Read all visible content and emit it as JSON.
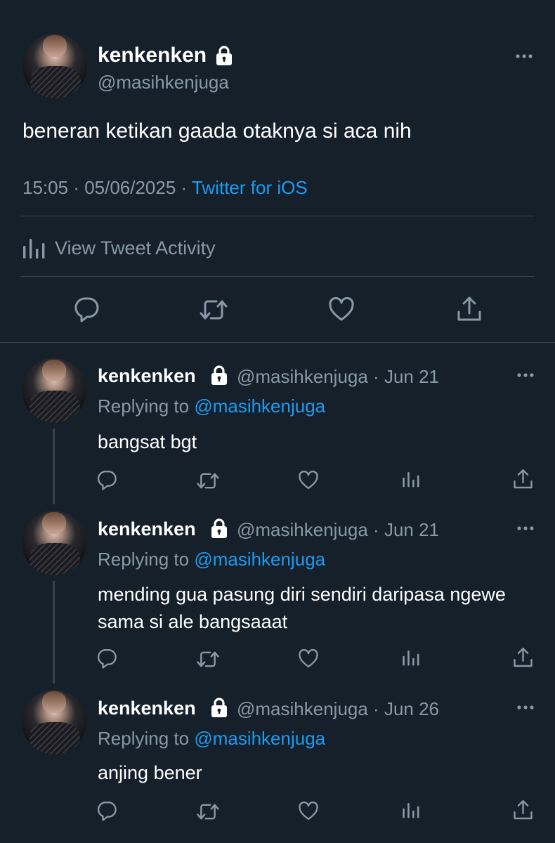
{
  "main_tweet": {
    "display_name": "kenkenken",
    "handle": "@masihkenjuga",
    "text": "beneran ketikan gaada otaknya si aca nih",
    "time": "15:05",
    "separator": " · ",
    "date": "05/06/2025",
    "source": "Twitter for iOS",
    "activity_label": "View Tweet Activity",
    "protected_icon": "lock-icon",
    "actions": [
      "reply-icon",
      "retweet-icon",
      "like-icon",
      "share-icon"
    ]
  },
  "replies": [
    {
      "display_name": "kenkenken",
      "handle": "@masihkenjuga",
      "separator": " · ",
      "date": "Jun 21",
      "replying_prefix": "Replying to ",
      "replying_to": "@masihkenjuga",
      "text": "bangsat bgt"
    },
    {
      "display_name": "kenkenken",
      "handle": "@masihkenjuga",
      "separator": " · ",
      "date": "Jun 21",
      "replying_prefix": "Replying to ",
      "replying_to": "@masihkenjuga",
      "text_line1": "mending gua pasung diri sendiri daripasa ngewe",
      "text_line2": "sama si ale bangsaaat"
    },
    {
      "display_name": "kenkenken",
      "handle": "@masihkenjuga",
      "separator": " · ",
      "date": "Jun 26",
      "replying_prefix": "Replying to ",
      "replying_to": "@masihkenjuga",
      "text": "anjing bener"
    }
  ],
  "colors": {
    "background": "#15202b",
    "text": "#ffffff",
    "secondary": "#8899a6",
    "accent": "#1d9bf0",
    "divider": "#38444d"
  }
}
